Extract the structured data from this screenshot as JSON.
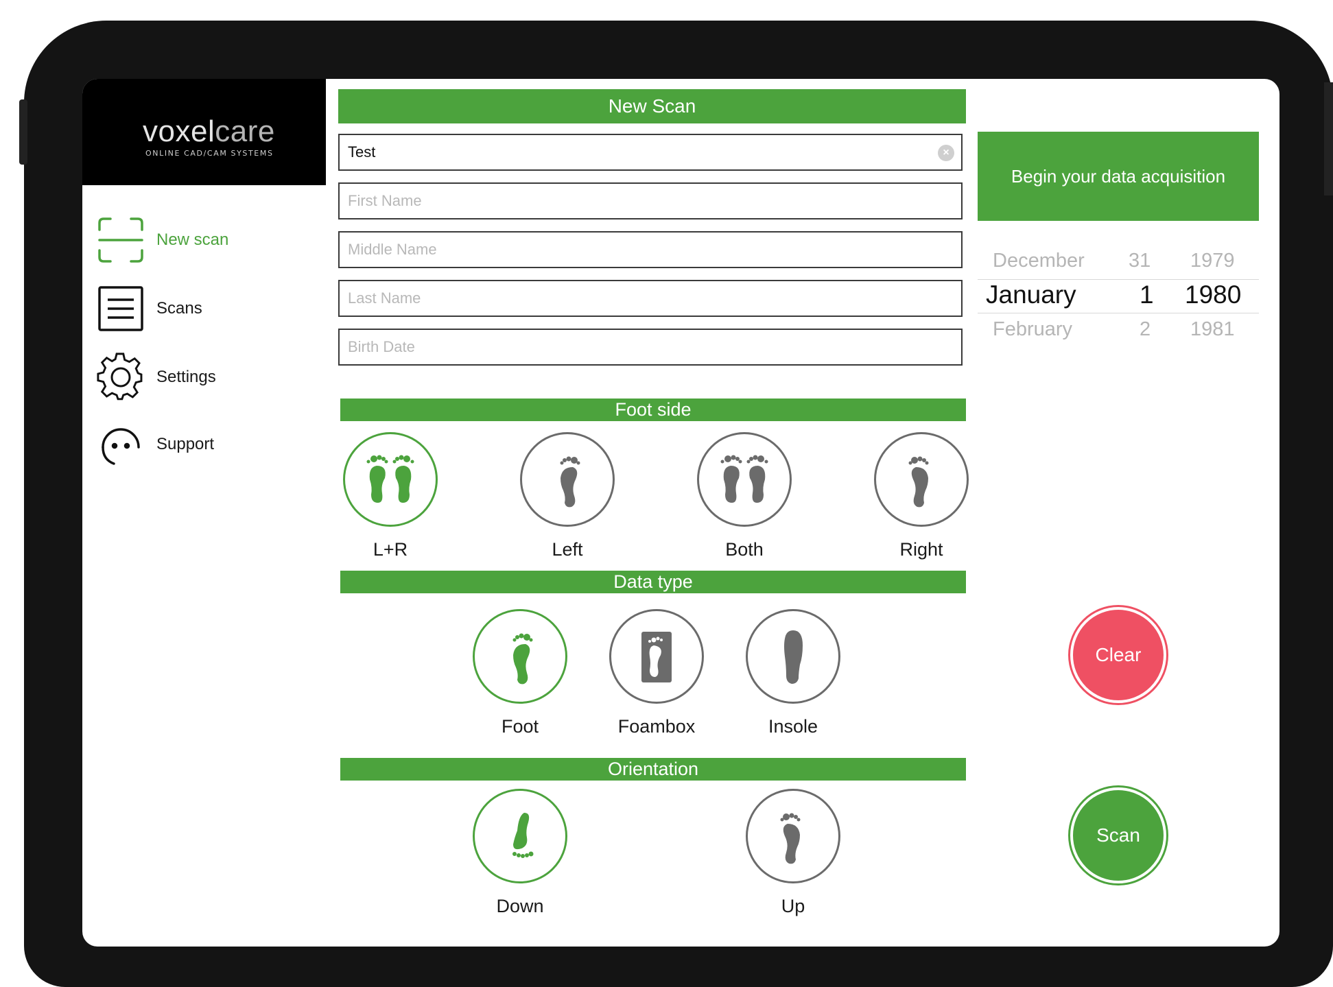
{
  "brand": {
    "name_part1": "voxel",
    "name_part2": "care",
    "tagline": "ONLINE CAD/CAM SYSTEMS"
  },
  "sidebar": {
    "items": [
      {
        "label": "New scan",
        "icon": "scan-frame-icon",
        "active": true
      },
      {
        "label": "Scans",
        "icon": "list-icon",
        "active": false
      },
      {
        "label": "Settings",
        "icon": "gear-icon",
        "active": false
      },
      {
        "label": "Support",
        "icon": "headset-icon",
        "active": false
      }
    ]
  },
  "form": {
    "title": "New Scan",
    "scan_name": {
      "value": "Test",
      "placeholder": ""
    },
    "first_name": {
      "value": "",
      "placeholder": "First Name"
    },
    "middle_name": {
      "value": "",
      "placeholder": "Middle Name"
    },
    "last_name": {
      "value": "",
      "placeholder": "Last Name"
    },
    "birth_date": {
      "value": "",
      "placeholder": "Birth Date"
    }
  },
  "foot_side": {
    "title": "Foot side",
    "options": [
      {
        "label": "L+R",
        "icon": "left-plus-right-feet-icon",
        "selected": true
      },
      {
        "label": "Left",
        "icon": "left-foot-icon",
        "selected": false
      },
      {
        "label": "Both",
        "icon": "both-feet-icon",
        "selected": false
      },
      {
        "label": "Right",
        "icon": "right-foot-icon",
        "selected": false
      }
    ]
  },
  "data_type": {
    "title": "Data type",
    "options": [
      {
        "label": "Foot",
        "icon": "foot-icon",
        "selected": true
      },
      {
        "label": "Foambox",
        "icon": "foambox-icon",
        "selected": false
      },
      {
        "label": "Insole",
        "icon": "insole-icon",
        "selected": false
      }
    ]
  },
  "orientation": {
    "title": "Orientation",
    "options": [
      {
        "label": "Down",
        "icon": "foot-down-icon",
        "selected": true
      },
      {
        "label": "Up",
        "icon": "foot-up-icon",
        "selected": false
      }
    ]
  },
  "begin_label": "Begin your data acquisition",
  "date_picker": {
    "prev": {
      "month": "December",
      "day": "31",
      "year": "1979"
    },
    "current": {
      "month": "January",
      "day": "1",
      "year": "1980"
    },
    "next": {
      "month": "February",
      "day": "2",
      "year": "1981"
    }
  },
  "actions": {
    "clear_label": "Clear",
    "scan_label": "Scan"
  },
  "colors": {
    "accent": "#4ca33d",
    "danger": "#ef5063",
    "device": "#141414"
  }
}
